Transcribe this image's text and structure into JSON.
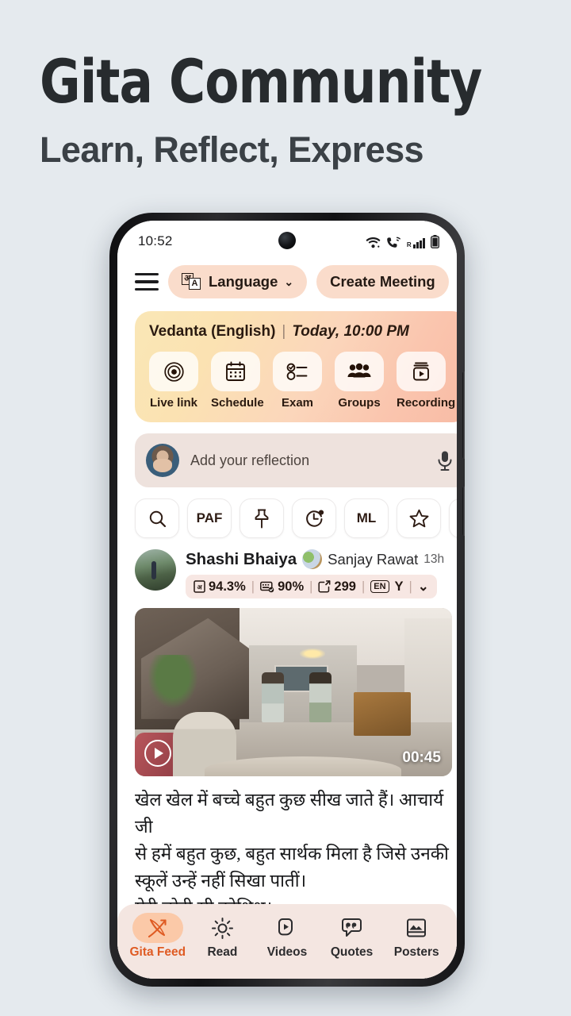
{
  "marketing": {
    "headline": "Gita Community",
    "subheadline": "Learn, Reflect, Express"
  },
  "colors": {
    "page_background": "#e5eaee",
    "pill_peach": "#fadccb",
    "accent_orange": "#df5b23",
    "banner_yellow": "#fae7b6",
    "banner_peach": "#f8bba5",
    "bottom_nav_bg": "#f4e6e1",
    "active_pill": "#fbc9a8",
    "stats_bg": "#f7e7e3",
    "reflect_bg": "#eee2dd"
  },
  "status_bar": {
    "time": "10:52",
    "icons": [
      "wifi-icon",
      "vowifi-call-icon",
      "signal-bars-icon",
      "battery-icon"
    ],
    "signal_roaming_label": "R"
  },
  "topnav": {
    "menu_icon": "hamburger-menu-icon",
    "language_button": {
      "label": "Language",
      "icon": "devanagari-latin-script-icon",
      "icon_glyph_1": "अ",
      "icon_glyph_2": "A",
      "chevron": "⌄"
    },
    "create_meeting_button": "Create Meeting"
  },
  "banner": {
    "title": "Vedanta (English)",
    "separator": "|",
    "schedule": "Today, 10:00 PM",
    "actions": [
      {
        "label": "Live link",
        "icon": "live-target-icon"
      },
      {
        "label": "Schedule",
        "icon": "calendar-icon"
      },
      {
        "label": "Exam",
        "icon": "checklist-icon"
      },
      {
        "label": "Groups",
        "icon": "people-group-icon"
      },
      {
        "label": "Recording",
        "icon": "recording-play-icon"
      }
    ]
  },
  "reflection": {
    "placeholder": "Add your reflection",
    "avatar": "user-avatar",
    "mic_icon": "microphone-icon"
  },
  "filter_chips": [
    {
      "type": "icon",
      "name": "search-icon",
      "label": ""
    },
    {
      "type": "text",
      "name": "paf-chip",
      "label": "PAF"
    },
    {
      "type": "icon",
      "name": "pin-icon",
      "label": ""
    },
    {
      "type": "icon",
      "name": "clock-notification-icon",
      "label": ""
    },
    {
      "type": "text",
      "name": "ml-chip",
      "label": "ML"
    },
    {
      "type": "icon",
      "name": "star-icon",
      "label": ""
    },
    {
      "type": "icon",
      "name": "checklist-lines-icon",
      "label": ""
    }
  ],
  "post": {
    "author": "Shashi Bhaiya",
    "secondary_author": "Sanjay Rawat",
    "time": "13h",
    "stats": {
      "reading_percent": "94.3%",
      "typing_percent": "90%",
      "notes_count": "299",
      "language_badge": "EN",
      "language_value": "Y",
      "expand_chevron": "⌄"
    },
    "video": {
      "duration": "00:45",
      "play_icon": "play-button-icon"
    },
    "text_lines": [
      "खेल खेल में बच्चे बहुत कुछ सीख जाते हैं। आचार्य जी",
      "से हमें बहुत कुछ, बहुत सार्थक मिला है जिसे उनकी",
      "स्कूलें उन्हें नहीं सिखा पातीं।",
      "मेरी छोटी सी कोशिश।"
    ]
  },
  "bottom_nav": {
    "items": [
      {
        "label": "Gita Feed",
        "icon": "bow-arrow-icon",
        "active": true
      },
      {
        "label": "Read",
        "icon": "sun-icon",
        "active": false
      },
      {
        "label": "Videos",
        "icon": "video-play-icon",
        "active": false
      },
      {
        "label": "Quotes",
        "icon": "quote-bubble-icon",
        "active": false
      },
      {
        "label": "Posters",
        "icon": "poster-image-icon",
        "active": false
      }
    ]
  }
}
